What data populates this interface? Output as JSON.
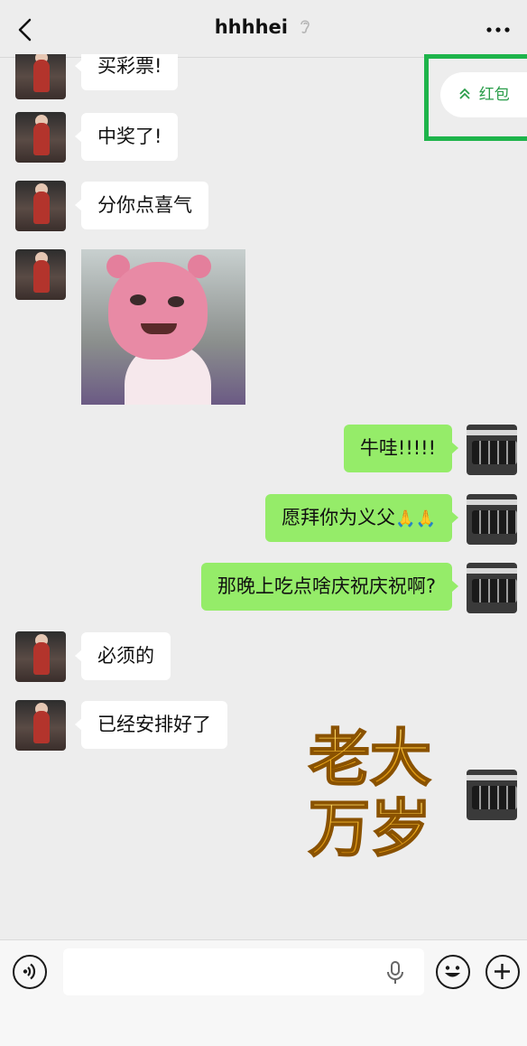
{
  "header": {
    "title": "hhhhei",
    "back_icon": "chevron-left-icon",
    "mute_icon": "ear-mute-icon",
    "more_icon": "more-dots-icon"
  },
  "red_packet": {
    "label": "红包",
    "chevron": "«"
  },
  "messages": [
    {
      "side": "left",
      "text": "买彩票!"
    },
    {
      "side": "left",
      "text": "中奖了!"
    },
    {
      "side": "left",
      "text": "分你点喜气"
    },
    {
      "side": "left",
      "type": "sticker",
      "sticker": "pink-pig-sticker"
    },
    {
      "side": "right",
      "text": "牛哇!!!!!"
    },
    {
      "side": "right",
      "text": "愿拜你为义父",
      "emoji": "🙏🙏"
    },
    {
      "side": "right",
      "text": "那晚上吃点啥庆祝庆祝啊?"
    },
    {
      "side": "left",
      "text": "必须的"
    },
    {
      "side": "left",
      "text": "已经安排好了"
    },
    {
      "side": "right",
      "type": "sticker",
      "sticker_text": [
        "老大",
        "万岁"
      ]
    }
  ],
  "input_bar": {
    "voice_icon": "voice-icon",
    "mic_icon": "microphone-icon",
    "emoji_icon": "emoji-icon",
    "plus_icon": "plus-icon"
  },
  "colors": {
    "background": "#ededed",
    "self_bubble": "#95ec69",
    "other_bubble": "#ffffff",
    "highlight": "#1eb44b",
    "red_packet_text": "#2a9d4a",
    "sticker_gold": "#f2b01e"
  }
}
